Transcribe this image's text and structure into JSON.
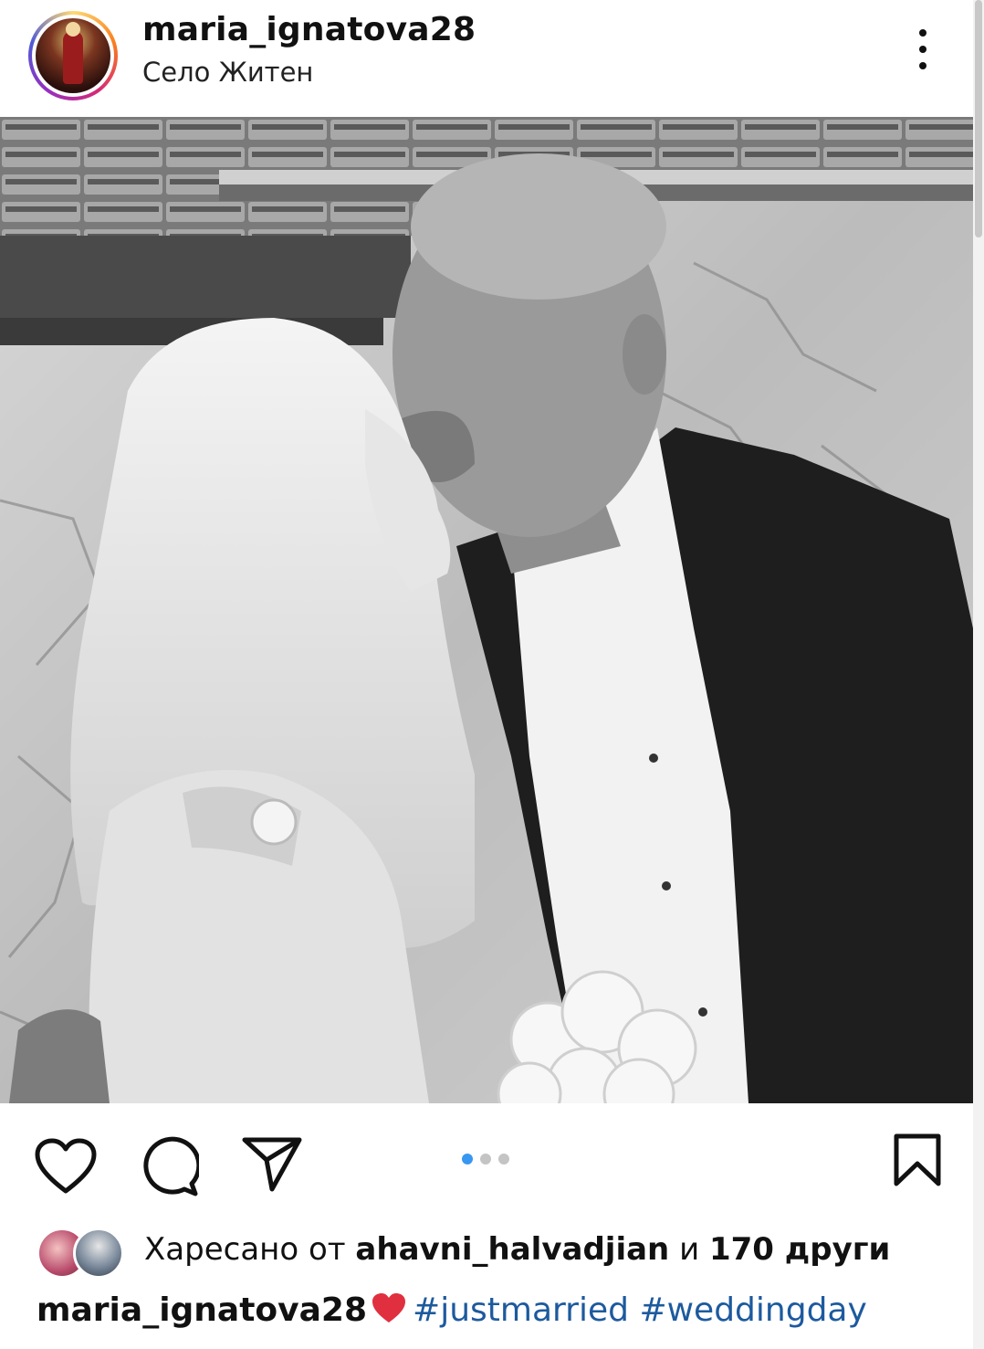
{
  "post": {
    "username": "maria_ignatova28",
    "location": "Село Житен",
    "carousel": {
      "total": 3,
      "active_index": 0
    }
  },
  "likes": {
    "prefix": "Харесано от",
    "user": "ahavni_halvadjian",
    "connector": "и",
    "others": "170 други"
  },
  "caption": {
    "username": "maria_ignatova28",
    "emoji": "red-heart",
    "hashtags": [
      "#justmarried",
      "#weddingday"
    ]
  },
  "colors": {
    "text": "#111111",
    "hashtag": "#1d5a9e",
    "carousel_active": "#3897f0",
    "carousel_inactive": "#c4c4c4",
    "heart": "#e0303f"
  },
  "icons": [
    "more-options-icon",
    "like-heart-icon",
    "comment-icon",
    "share-icon",
    "bookmark-icon"
  ]
}
